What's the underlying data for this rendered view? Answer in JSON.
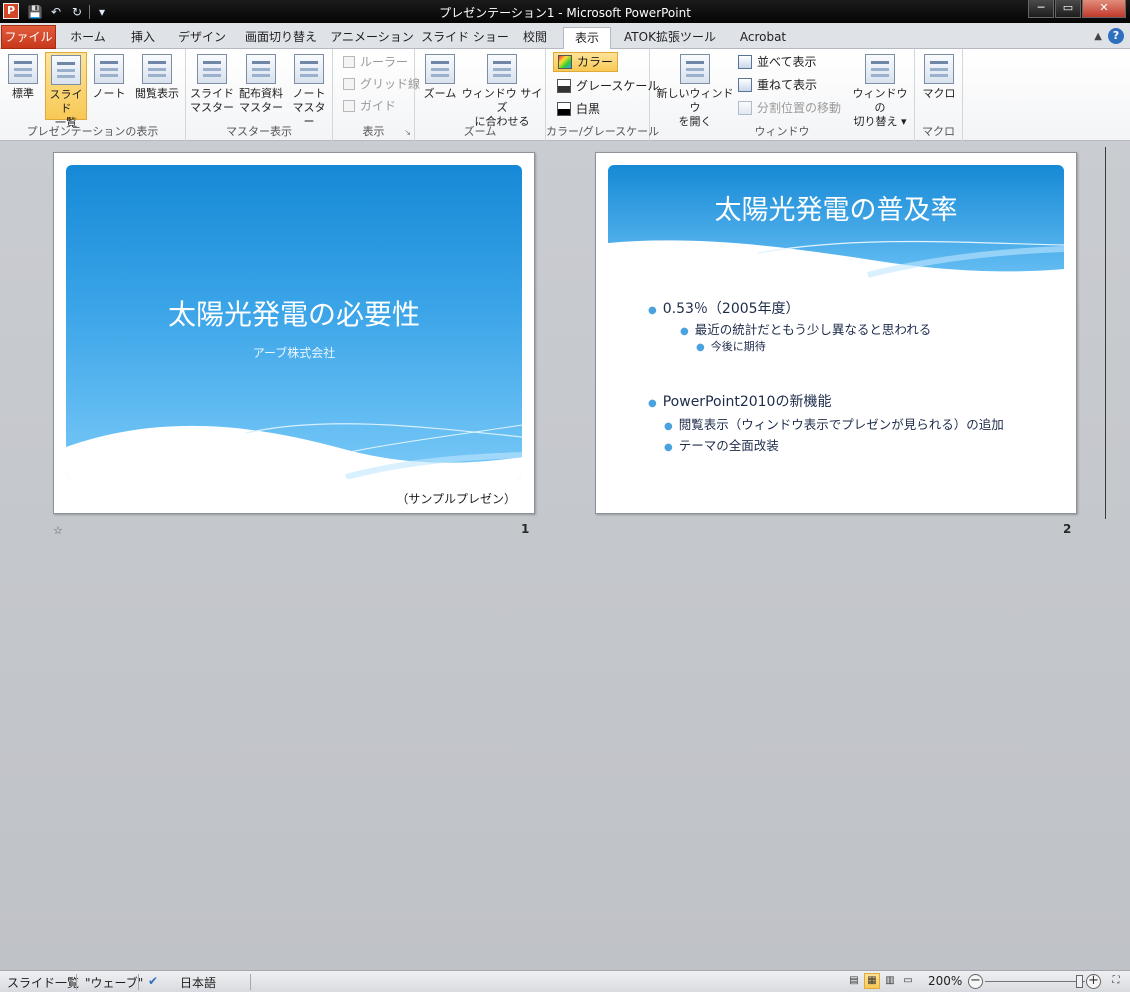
{
  "window": {
    "title": "プレゼンテーション1 - Microsoft PowerPoint",
    "app_icon_letter": "P",
    "controls": {
      "minimize": "─",
      "maximize": "▭",
      "close": "✕"
    }
  },
  "qat": {
    "save": "💾",
    "undo": "↶",
    "redo": "↻",
    "more": "▾"
  },
  "tabs": [
    {
      "label": "ファイル"
    },
    {
      "label": "ホーム"
    },
    {
      "label": "挿入"
    },
    {
      "label": "デザイン"
    },
    {
      "label": "画面切り替え"
    },
    {
      "label": "アニメーション"
    },
    {
      "label": "スライド ショー"
    },
    {
      "label": "校閲"
    },
    {
      "label": "表示"
    },
    {
      "label": "ATOK拡張ツール"
    },
    {
      "label": "Acrobat"
    }
  ],
  "ribbon": {
    "presentation_views": {
      "label": "プレゼンテーションの表示",
      "normal": "標準",
      "sorter_1": "スライド",
      "sorter_2": "一覧",
      "notes": "ノート",
      "reading": "閲覧表示"
    },
    "master_views": {
      "label": "マスター表示",
      "slide_1": "スライド",
      "slide_2": "マスター",
      "handout_1": "配布資料",
      "handout_2": "マスター",
      "notes_1": "ノート",
      "notes_2": "マスター"
    },
    "show": {
      "label": "表示",
      "ruler": "ルーラー",
      "gridlines": "グリッド線",
      "guides": "ガイド",
      "launcher": "↘"
    },
    "zoom": {
      "label": "ズーム",
      "zoom": "ズーム",
      "fit_1": "ウィンドウ サイズ",
      "fit_2": "に合わせる"
    },
    "color": {
      "label": "カラー/グレースケール",
      "color": "カラー",
      "grayscale": "グレースケール",
      "bw": "白黒"
    },
    "window": {
      "label": "ウィンドウ",
      "new_1": "新しいウィンドウ",
      "new_2": "を開く",
      "arrange": "並べて表示",
      "cascade": "重ねて表示",
      "split": "分割位置の移動",
      "switch_1": "ウィンドウの",
      "switch_2": "切り替え ▾"
    },
    "macros": {
      "label": "マクロ",
      "macros": "マクロ"
    }
  },
  "slides": [
    {
      "number": "1",
      "title": "太陽光発電の必要性",
      "subtitle": "アーブ株式会社",
      "footer": "（サンプルプレゼン）",
      "transition_icon": "☆"
    },
    {
      "number": "2",
      "title": "太陽光発電の普及率",
      "bullets": [
        "0.53％（2005年度）",
        "最近の統計だともう少し異なると思われる",
        "今後に期待",
        "PowerPoint2010の新機能",
        "閲覧表示（ウィンドウ表示でプレゼンが見られる）の追加",
        "テーマの全面改装"
      ]
    }
  ],
  "statusbar": {
    "view": "スライド一覧",
    "theme": "\"ウェーブ\"",
    "language": "日本語",
    "zoom": "200%",
    "zoom_minus": "−",
    "zoom_plus": "+"
  },
  "colors": {
    "accent_file_tab": "#d24726",
    "slide_blue": "#1689d6",
    "bullet": "#4aa3df"
  }
}
